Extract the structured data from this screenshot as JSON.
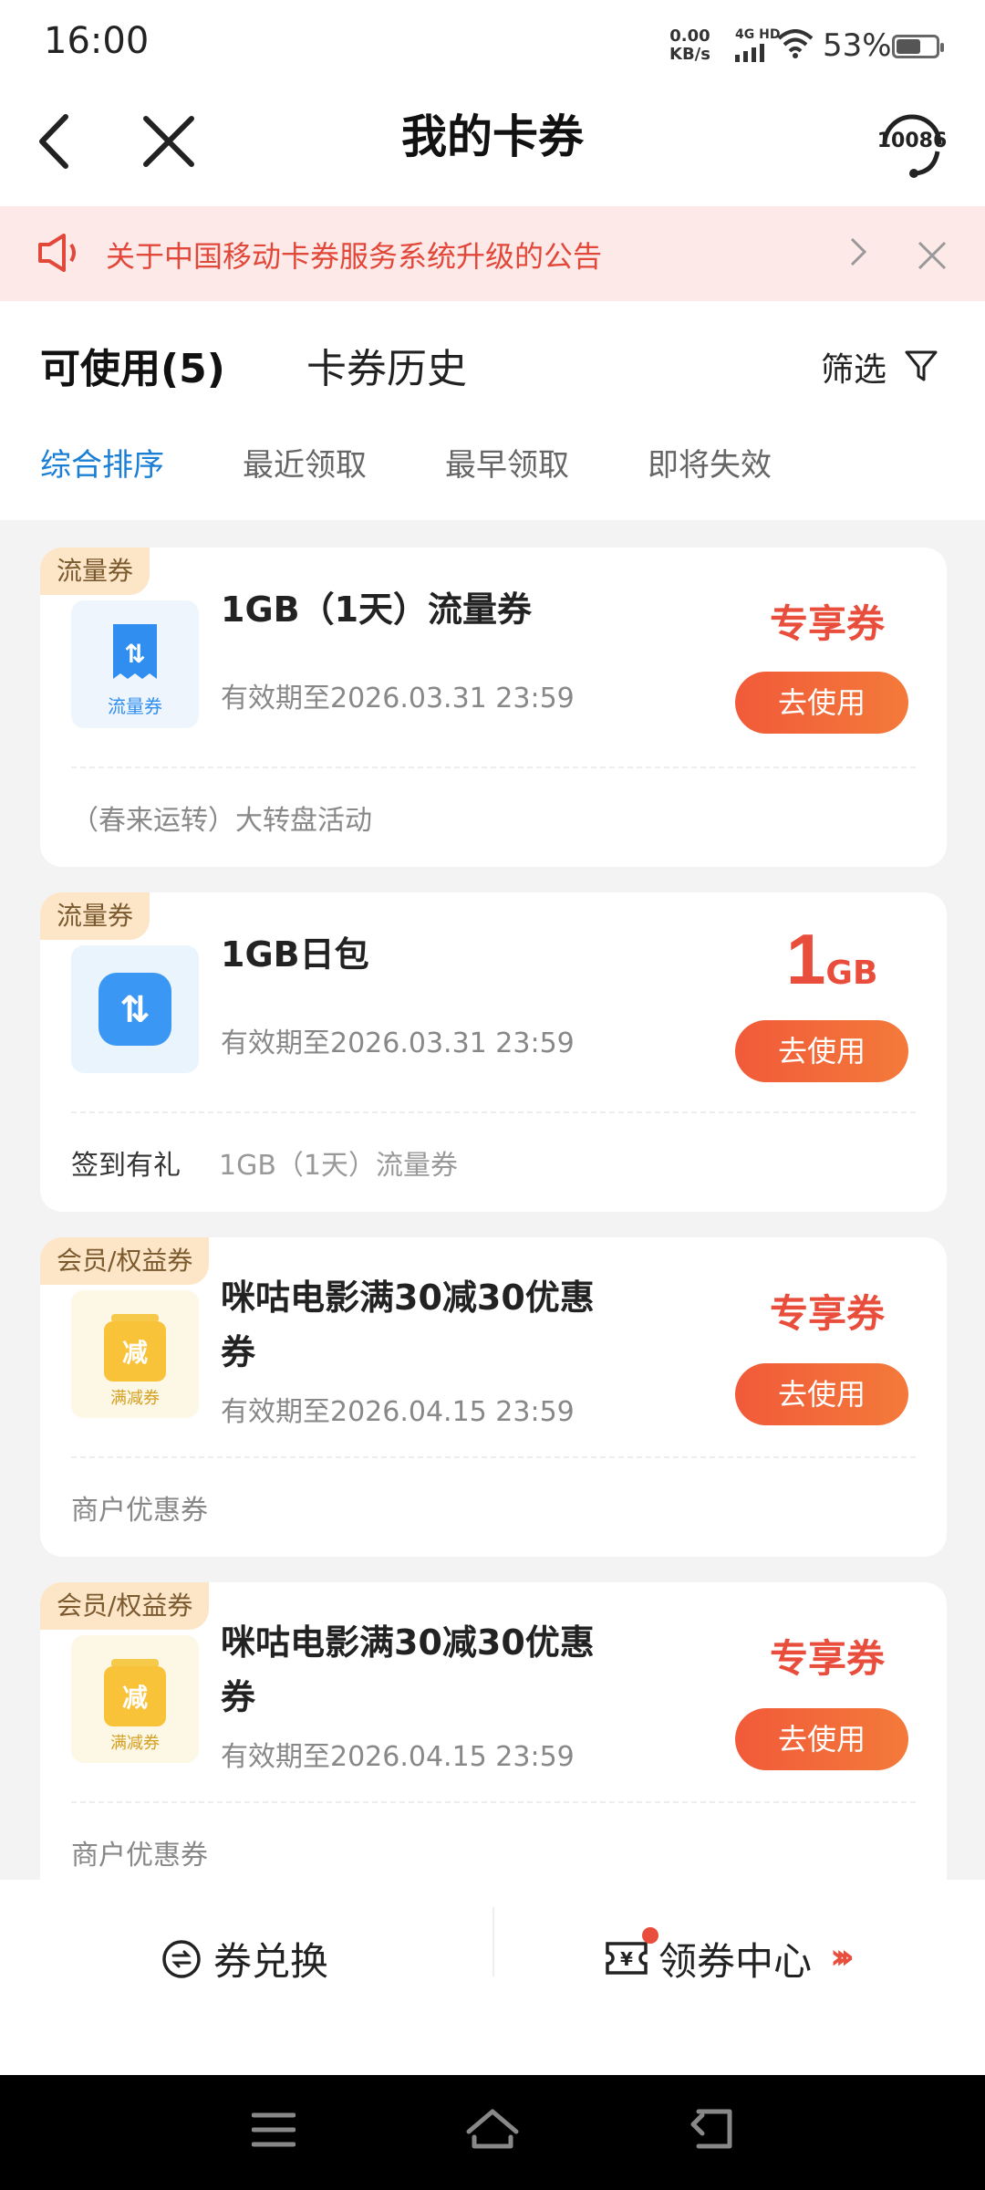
{
  "status_bar": {
    "time": "16:00",
    "net_speed": "0.00",
    "net_unit": "KB/s",
    "network": "4G HD",
    "battery": "53%"
  },
  "nav": {
    "title": "我的卡券",
    "service_number": "10086"
  },
  "notice": {
    "text": "关于中国移动卡券服务系统升级的公告"
  },
  "tabs": {
    "available": "可使用(5)",
    "history": "卡券历史",
    "filter": "筛选"
  },
  "sort": [
    "综合排序",
    "最近领取",
    "最早领取",
    "即将失效"
  ],
  "coupons": [
    {
      "tag": "流量券",
      "icon_label": "流量券",
      "title": "1GB（1天）流量券",
      "expiry": "有效期至2026.03.31 23:59",
      "badge": "专享券",
      "button": "去使用",
      "source": "（春来运转）大转盘活动"
    },
    {
      "tag": "流量券",
      "icon_label": "",
      "title": "1GB日包",
      "expiry": "有效期至2026.03.31 23:59",
      "amount": "1",
      "amount_unit": "GB",
      "button": "去使用",
      "source": "签到有礼",
      "source_detail": "1GB（1天）流量券"
    },
    {
      "tag": "会员/权益券",
      "icon_label": "满减券",
      "icon_char": "减",
      "title": "咪咕电影满30减30优惠券",
      "expiry": "有效期至2026.04.15 23:59",
      "badge": "专享券",
      "button": "去使用",
      "source": "商户优惠券"
    },
    {
      "tag": "会员/权益券",
      "icon_label": "满减券",
      "icon_char": "减",
      "title": "咪咕电影满30减30优惠券",
      "expiry": "有效期至2026.04.15 23:59",
      "badge": "专享券",
      "button": "去使用",
      "source": "商户优惠券"
    }
  ],
  "bottom": {
    "exchange": "券兑换",
    "center": "领券中心"
  },
  "colors": {
    "accent_red": "#e94d3c",
    "active_blue": "#1a7fd4",
    "tag_bg": "#fde5c7"
  }
}
